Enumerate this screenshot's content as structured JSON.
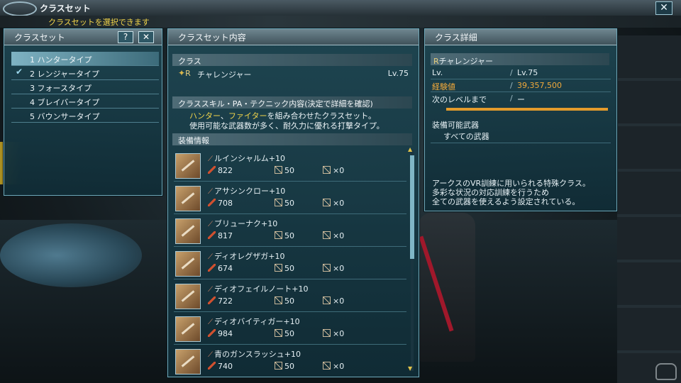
{
  "window": {
    "title": "クラスセット",
    "hint": "クラスセットを選択できます",
    "close_label": "✕"
  },
  "class_set_panel": {
    "title": "クラスセット",
    "help_label": "?",
    "close_label": "✕",
    "items": [
      {
        "label": "1 ハンタータイプ",
        "selected": false,
        "checked": false
      },
      {
        "label": "2 レンジャータイプ",
        "selected": false,
        "checked": true
      },
      {
        "label": "3 フォースタイプ",
        "selected": false,
        "checked": false
      },
      {
        "label": "4 ブレイバータイプ",
        "selected": false,
        "checked": false
      },
      {
        "label": "5 バウンサータイプ",
        "selected": false,
        "checked": false
      }
    ],
    "check_mark": "✔"
  },
  "class_set_contents": {
    "title": "クラスセット内容",
    "class_section_label": "クラス",
    "class_emblem": "✦",
    "class_emblem_r": "R",
    "class_name": "チャレンジャー",
    "class_level": "Lv.75",
    "skill_section_label": "クラススキル・PA・テクニック内容(決定で詳細を確認)",
    "description_hl1": "ハンター",
    "description_sep": "、",
    "description_hl2": "ファイター",
    "description_line1_rest": "を組み合わせたクラスセット。",
    "description_line2": "使用可能な武器数が多く、耐久力に優れる打撃タイプ。",
    "equip_section_label": "装備情報",
    "equipment": [
      {
        "name": "ルインシャルム+10",
        "attack": "822",
        "stat2": "50",
        "stat3": "×0"
      },
      {
        "name": "アサシンクロー+10",
        "attack": "708",
        "stat2": "50",
        "stat3": "×0"
      },
      {
        "name": "ブリューナク+10",
        "attack": "817",
        "stat2": "50",
        "stat3": "×0"
      },
      {
        "name": "ディオレグザガ+10",
        "attack": "674",
        "stat2": "50",
        "stat3": "×0"
      },
      {
        "name": "ディオフェイルノート+10",
        "attack": "722",
        "stat2": "50",
        "stat3": "×0"
      },
      {
        "name": "ディオバイティガー+10",
        "attack": "984",
        "stat2": "50",
        "stat3": "×0"
      },
      {
        "name": "青のガンスラッシュ+10",
        "attack": "740",
        "stat2": "50",
        "stat3": "×0"
      }
    ],
    "scroll_up": "▲",
    "scroll_down": "▼"
  },
  "class_detail": {
    "title": "クラス詳細",
    "class_emblem_r": "R",
    "class_name": "チャレンジャー",
    "rows": [
      {
        "key": "Lv.",
        "value": "Lv.75",
        "accent": false
      },
      {
        "key": "経験値",
        "value": "39,357,500",
        "accent": true
      },
      {
        "key": "次のレベルまで",
        "value": "ー",
        "accent": false
      }
    ],
    "separator": "/",
    "weapons_label": "装備可能武器",
    "weapons_value": "すべての武器",
    "description_lines": [
      "アークスのVR訓練に用いられる特殊クラス。",
      "多彩な状況の対応訓練を行うため",
      "全ての武器を使えるよう設定されている。"
    ]
  },
  "colors": {
    "accent_yellow": "#f1d44a",
    "accent_orange": "#f1a93a",
    "panel_border": "#6fa7b8"
  }
}
